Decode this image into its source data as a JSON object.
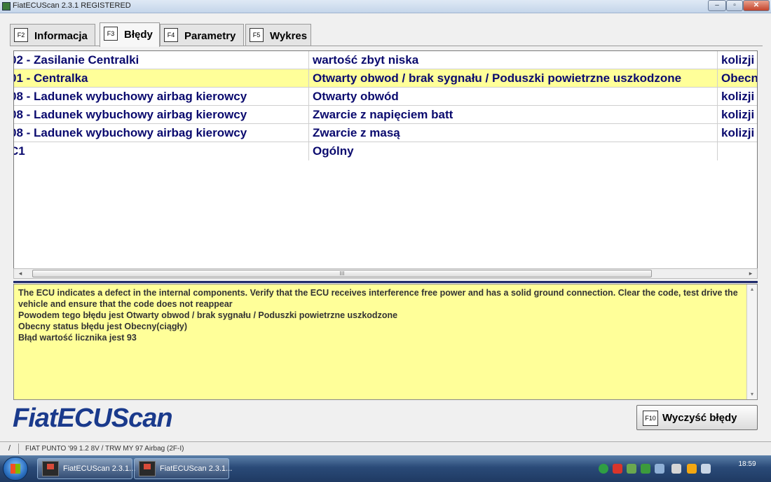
{
  "window": {
    "title": "FiatECUScan 2.3.1 REGISTERED",
    "min_glyph": "–",
    "max_glyph": "▫",
    "close_glyph": "✕"
  },
  "tabs": [
    {
      "key": "F2",
      "label": "Informacja"
    },
    {
      "key": "F3",
      "label": "Błędy"
    },
    {
      "key": "F4",
      "label": "Parametry"
    },
    {
      "key": "F5",
      "label": "Wykres"
    }
  ],
  "errors": {
    "selected_index": 1,
    "rows": [
      {
        "code": "02 - Zasilanie Centralki",
        "description": "wartość zbyt niska",
        "status": "kolizji"
      },
      {
        "code": "01 - Centralka",
        "description": "Otwarty obwod / brak sygnału / Poduszki powietrzne uszkodzone",
        "status": "Obecn"
      },
      {
        "code": "08 - Ladunek wybuchowy airbag kierowcy",
        "description": "Otwarty obwód",
        "status": "kolizji"
      },
      {
        "code": "08 - Ladunek wybuchowy airbag kierowcy",
        "description": "Zwarcie z napięciem batt",
        "status": "kolizji"
      },
      {
        "code": "08 - Ladunek wybuchowy airbag kierowcy",
        "description": "Zwarcie z masą",
        "status": "kolizji"
      },
      {
        "code": "C1",
        "description": "Ogólny",
        "status": ""
      }
    ]
  },
  "scrollbar": {
    "left": "◂",
    "right": "▸",
    "grip": "III"
  },
  "details": {
    "lines": [
      "The ECU indicates a defect in the internal components. Verify that the ECU receives interference free power and has a solid ground connection. Clear the code, test drive the vehicle and ensure that the code does not reappear",
      "Powodem tego błędu jest Otwarty obwod / brak sygnału / Poduszki powietrzne uszkodzone",
      "Obecny status błędu jest Obecny(ciągły)",
      "Błąd wartość licznika jest 93"
    ],
    "scroll_up": "▴",
    "scroll_down": "▾"
  },
  "logo": "FiatECUScan",
  "clear_button": {
    "key": "F10",
    "label": "Wyczyść błędy"
  },
  "status_bar": {
    "separator": "/",
    "vehicle": "FIAT PUNTO '99 1.2 8V / TRW MY 97 Airbag (2F-I)"
  },
  "taskbar": {
    "items": [
      {
        "label": "FiatECUScan 2.3.1..."
      },
      {
        "label": "FiatECUScan 2.3.1..."
      }
    ],
    "clock": "18:59"
  },
  "colors": {
    "selected_row": "#ffff99",
    "details_bg": "#ffff99",
    "table_text": "#0a0a6e",
    "logo": "#1a3a8c"
  },
  "icons": [
    "app-icon",
    "start-icon",
    "fiatecuscan-icon",
    "tray-icons",
    "scroll-arrow-icons"
  ]
}
